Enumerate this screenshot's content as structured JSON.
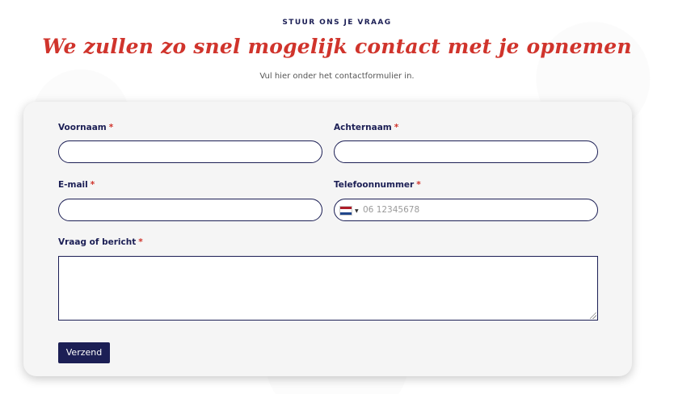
{
  "section": {
    "eyebrow": "STUUR ONS JE VRAAG",
    "headline": "We zullen zo snel mogelijk contact met je opnemen",
    "subline": "Vul hier onder het contactformulier in."
  },
  "form": {
    "required_marker": "*",
    "first_name": {
      "label": "Voornaam",
      "value": ""
    },
    "last_name": {
      "label": "Achternaam",
      "value": ""
    },
    "email": {
      "label": "E-mail",
      "value": ""
    },
    "phone": {
      "label": "Telefoonnummer",
      "placeholder": "06 12345678",
      "country_icon": "netherlands-flag-icon",
      "flag_colors": [
        "#ae1c28",
        "#ffffff",
        "#21468b"
      ]
    },
    "message": {
      "label": "Vraag of bericht",
      "value": ""
    },
    "submit_label": "Verzend"
  },
  "colors": {
    "navy": "#1c1f55",
    "accent_red": "#d0342c",
    "card_bg": "#f5f5f5"
  }
}
